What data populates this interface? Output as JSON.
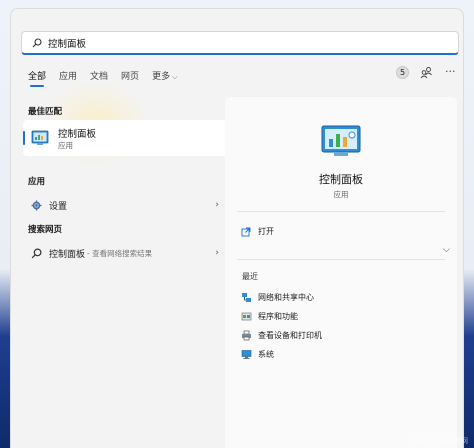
{
  "search": {
    "value": "控制面板"
  },
  "tabs": [
    {
      "label": "全部",
      "active": true
    },
    {
      "label": "应用"
    },
    {
      "label": "文档"
    },
    {
      "label": "网页"
    },
    {
      "label": "更多"
    }
  ],
  "header": {
    "points": "5"
  },
  "left": {
    "best_match_title": "最佳匹配",
    "best_match": {
      "name": "控制面板",
      "type": "应用"
    },
    "apps_title": "应用",
    "apps": [
      {
        "label": "设置"
      }
    ],
    "web_title": "搜索网页",
    "web": [
      {
        "label": "控制面板",
        "sub": "- 查看网络搜索结果"
      }
    ]
  },
  "right": {
    "app_name": "控制面板",
    "app_type": "应用",
    "open_label": "打开",
    "recent_title": "最近",
    "recent": [
      {
        "label": "网络和共享中心",
        "icon": "network-icon"
      },
      {
        "label": "程序和功能",
        "icon": "programs-icon"
      },
      {
        "label": "查看设备和打印机",
        "icon": "printer-icon"
      },
      {
        "label": "系统",
        "icon": "system-icon"
      }
    ]
  },
  "watermark": "CSDN @迅达腾网",
  "colors": {
    "accent": "#1f6fd1",
    "panel": "#f3f3f3",
    "taskbar": "#1f3f8f"
  }
}
